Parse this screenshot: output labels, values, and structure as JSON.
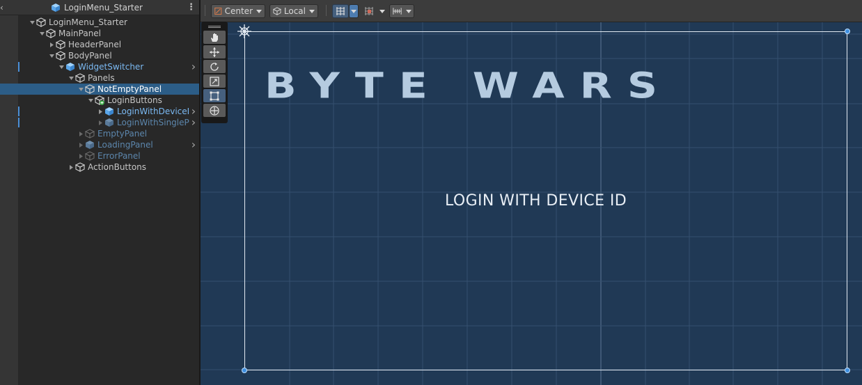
{
  "hierarchy": {
    "title": "LoginMenu_Starter",
    "items": [
      {
        "label": "LoginMenu_Starter",
        "indent": 0,
        "expanded": true,
        "type": "object"
      },
      {
        "label": "MainPanel",
        "indent": 1,
        "expanded": true,
        "type": "object"
      },
      {
        "label": "HeaderPanel",
        "indent": 2,
        "expanded": false,
        "type": "object"
      },
      {
        "label": "BodyPanel",
        "indent": 2,
        "expanded": true,
        "type": "object"
      },
      {
        "label": "WidgetSwitcher",
        "indent": 3,
        "expanded": true,
        "type": "prefab"
      },
      {
        "label": "Panels",
        "indent": 4,
        "expanded": true,
        "type": "object"
      },
      {
        "label": "NotEmptyPanel",
        "indent": 5,
        "expanded": true,
        "type": "object",
        "selected": true
      },
      {
        "label": "LoginButtons",
        "indent": 6,
        "expanded": true,
        "type": "object-added"
      },
      {
        "label": "LoginWithDeviceI",
        "indent": 7,
        "expanded": false,
        "type": "prefab"
      },
      {
        "label": "LoginWithSingleP",
        "indent": 7,
        "expanded": false,
        "type": "prefab-dim"
      },
      {
        "label": "EmptyPanel",
        "indent": 5,
        "expanded": false,
        "type": "dim"
      },
      {
        "label": "LoadingPanel",
        "indent": 5,
        "expanded": false,
        "type": "prefab-dim"
      },
      {
        "label": "ErrorPanel",
        "indent": 5,
        "expanded": false,
        "type": "dim"
      },
      {
        "label": "ActionButtons",
        "indent": 4,
        "expanded": false,
        "type": "object"
      }
    ]
  },
  "toolbar": {
    "pivot_mode": "Center",
    "pivot_rotation": "Local"
  },
  "canvas": {
    "logo_text": "BYTE WARS",
    "login_button_text": "LOGIN WITH DEVICE ID"
  },
  "colors": {
    "accent": "#2c5d87",
    "prefab_text": "#7bb9f2",
    "scene_bg": "#203955"
  }
}
